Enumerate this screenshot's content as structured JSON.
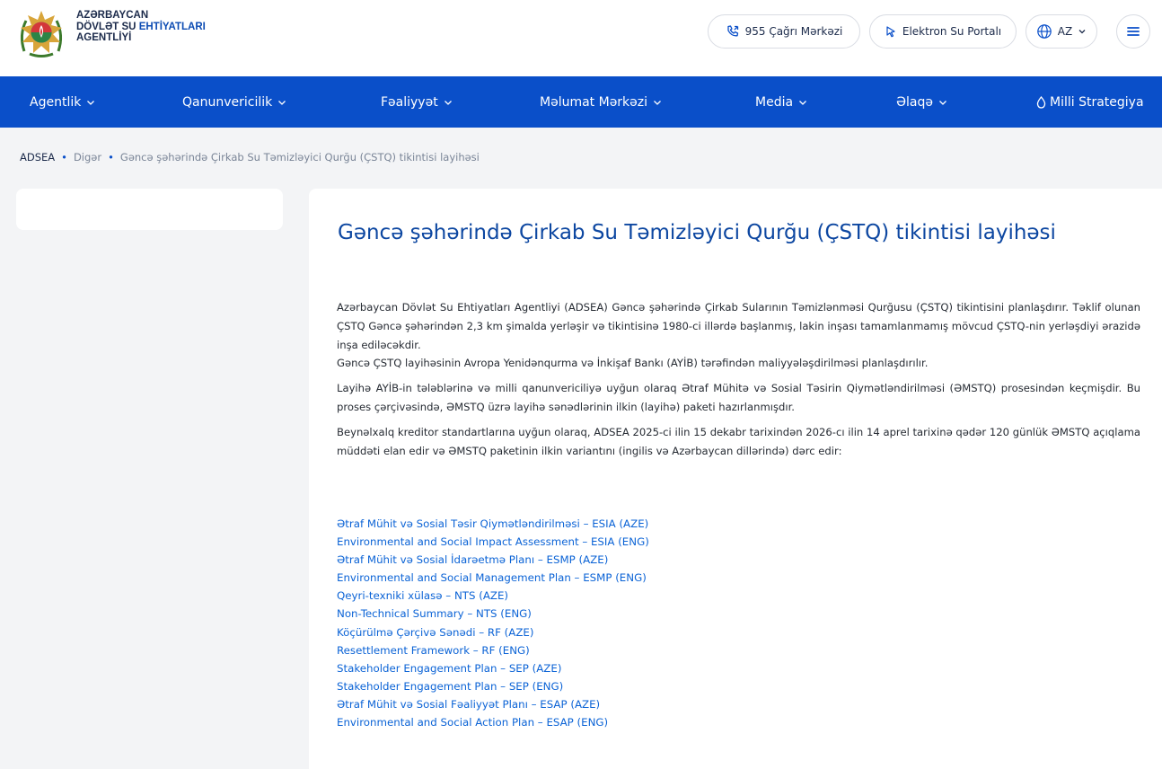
{
  "header": {
    "org_line1": "AZƏRBAYCAN",
    "org_line2a": "DÖVLƏT SU",
    "org_line2b": "EHTİYATLARI",
    "org_line3": "AGENTLİYİ",
    "call_center": "955 Çağrı Mərkəzi",
    "portal": "Elektron Su Portalı",
    "language": "AZ"
  },
  "nav": {
    "items": [
      {
        "label": "Agentlik"
      },
      {
        "label": "Qanunvericilik"
      },
      {
        "label": "Fəaliyyət"
      },
      {
        "label": "Məlumat Mərkəzi"
      },
      {
        "label": "Media"
      },
      {
        "label": "Əlaqə"
      },
      {
        "label": "Milli Strategiya"
      }
    ]
  },
  "breadcrumb": {
    "home": "ADSEA",
    "section": "Digər",
    "current": "Gəncə şəhərində Çirkab Su Təmizləyici Qurğu (ÇSTQ) tikintisi layihəsi"
  },
  "article": {
    "title": "Gəncə şəhərində Çirkab Su Təmizləyici Qurğu (ÇSTQ) tikintisi layihəsi",
    "p1": "Azərbaycan Dövlət Su Ehtiyatları Agentliyi (ADSEA) Gəncə şəhərində Çirkab Sularının Təmizlənməsi Qurğusu (ÇSTQ) tikintisini planlaşdırır. Təklif olunan ÇSTQ Gəncə şəhərindən 2,3 km şimalda yerləşir və tikintisinə 1980-ci illərdə başlanmış, lakin inşası tamamlanmamış mövcud ÇSTQ-nin yerləşdiyi ərazidə inşa ediləcəkdir.",
    "p2": "Gəncə ÇSTQ layihəsinin Avropa Yenidənqurma və İnkişaf Bankı (AYİB) tərəfindən maliyyələşdirilməsi planlaşdırılır.",
    "p3": "Layihə AYİB-in tələblərinə və milli qanunvericiliyə uyğun olaraq Ətraf Mühitə və Sosial Təsirin Qiymətləndirilməsi (ƏMSTQ) prosesindən keçmişdir. Bu proses çərçivəsində, ƏMSTQ üzrə layihə sənədlərinin ilkin (layihə) paketi hazırlanmışdır.",
    "p4": "Beynəlxalq kreditor standartlarına uyğun olaraq, ADSEA 2025-ci ilin 15 dekabr tarixindən 2026-cı ilin 14 aprel tarixinə qədər 120 günlük ƏMSTQ açıqlama müddəti elan edir və ƏMSTQ paketinin ilkin variantını (ingilis və Azərbaycan dillərində) dərc edir:",
    "links": [
      {
        "label": "Ətraf Mühit və Sosial Təsir Qiymətləndirilməsi – ESIA (AZE)"
      },
      {
        "label": "Environmental and Social Impact Assessment – ESIA (ENG)"
      },
      {
        "label": "Ətraf Mühit və Sosial İdarəetmə Planı – ESMP (AZE)"
      },
      {
        "label": "Environmental and Social Management Plan – ESMP (ENG)"
      },
      {
        "label": "Qeyri-texniki xülasə – NTS (AZE)"
      },
      {
        "label": "Non-Technical Summary – NTS (ENG)"
      },
      {
        "label": "Köçürülmə Çərçivə Sənədi – RF (AZE)"
      },
      {
        "label": "Resettlement Framework – RF (ENG)"
      },
      {
        "label": "Stakeholder Engagement Plan – SEP (AZE)"
      },
      {
        "label": "Stakeholder Engagement Plan – SEP (ENG)"
      },
      {
        "label": "Ətraf Mühit və Sosial Fəaliyyət Planı – ESAP (AZE)"
      },
      {
        "label": "Environmental and Social Action Plan – ESAP (ENG)"
      }
    ]
  },
  "colors": {
    "nav_bg": "#0a4fc9",
    "title": "#0d47a1",
    "link": "#0b63d6",
    "page_bg": "#f3f4f6"
  },
  "icons": {
    "logo": "state-emblem-icon",
    "call": "phone-icon",
    "portal": "cursor-icon",
    "language": "globe-icon",
    "menu": "hamburger-icon",
    "dropdown": "chevron-down-icon",
    "strategy": "water-drop-icon"
  }
}
